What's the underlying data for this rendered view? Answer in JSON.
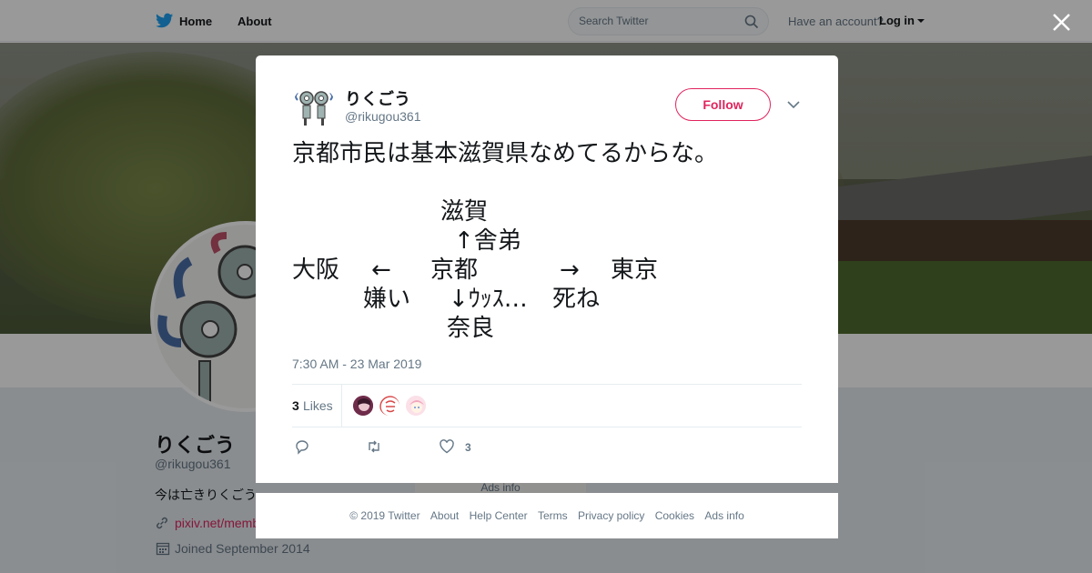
{
  "nav": {
    "home_label": "Home",
    "about_label": "About",
    "search_placeholder": "Search Twitter",
    "have_account": "Have an account?",
    "login_label": "Log in"
  },
  "profile": {
    "name": "りくごう",
    "handle": "@rikugou361",
    "bio": "今は亡きりくごう",
    "link": "pixiv.net/memb",
    "joined": "Joined September 2014",
    "ads_info": "Ads info"
  },
  "tweet": {
    "author_name": "りくごう",
    "author_handle": "@rikugou361",
    "follow_label": "Follow",
    "text_line1": "京都市民は基本滋賀県なめてるからな。",
    "diagram": {
      "shiga": "滋賀",
      "shatei": "↑舎弟",
      "osaka": "大阪",
      "arrow_left": "←",
      "kyoto": "京都",
      "arrow_right": "→",
      "tokyo": "東京",
      "kirai": "嫌い",
      "uss": "↓ｳｯｽ…",
      "shine": "死ね",
      "nara": "奈良"
    },
    "timestamp": "7:30 AM - 23 Mar 2019",
    "likes_count": "3",
    "likes_label": "Likes",
    "like_action_count": "3"
  },
  "footer": {
    "copyright": "© 2019 Twitter",
    "about": "About",
    "help": "Help Center",
    "terms": "Terms",
    "privacy": "Privacy policy",
    "cookies": "Cookies",
    "ads": "Ads info"
  },
  "icons": [
    "twitter-bird-icon",
    "search-icon",
    "close-icon",
    "chevron-down-icon",
    "reply-icon",
    "retweet-icon",
    "heart-icon",
    "link-icon",
    "calendar-icon"
  ],
  "colors": {
    "brand": "#1da1f2",
    "accent": "#e0245e",
    "text": "#14171a",
    "muted": "#657786"
  }
}
